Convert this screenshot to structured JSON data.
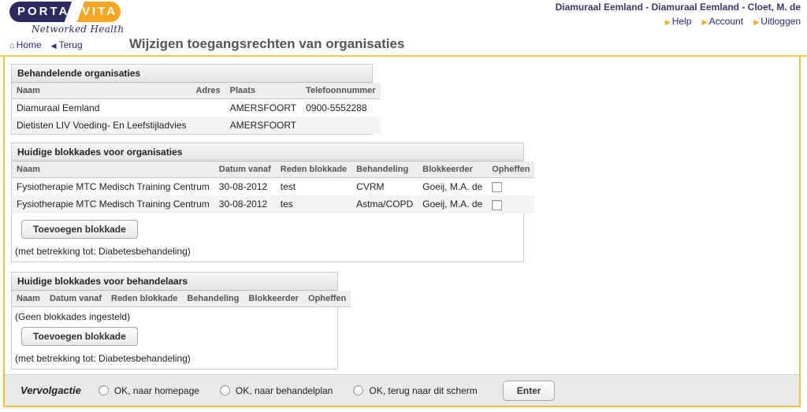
{
  "header": {
    "logo": {
      "text_left": "PORTA",
      "text_right": "VITA",
      "tagline": "Networked Health"
    },
    "user_context": "Diamuraal Eemland - Diamuraal Eemland - Cloet, M. de",
    "links": [
      {
        "label": "Help",
        "icon": "arrow-right-icon"
      },
      {
        "label": "Account",
        "icon": "arrow-right-icon"
      },
      {
        "label": "Uitloggen",
        "icon": "arrow-right-icon"
      }
    ]
  },
  "nav": {
    "home_label": "Home",
    "home_icon": "home-icon",
    "back_label": "Terug",
    "back_icon": "arrow-left-icon"
  },
  "page_title": "Wijzigen toegangsrechten van organisaties",
  "sections": {
    "organisaties": {
      "title": "Behandelende organisaties",
      "columns": [
        "Naam",
        "Adres",
        "Plaats",
        "Telefoonnummer"
      ],
      "rows": [
        {
          "naam": "Diamuraal Eemland",
          "adres": "",
          "plaats": "AMERSFOORT",
          "telefoonnummer": "0900-5552288"
        },
        {
          "naam": "Dietisten LIV Voeding- En Leefstijladvies",
          "adres": "",
          "plaats": "AMERSFOORT",
          "telefoonnummer": ""
        }
      ]
    },
    "blokkades_organisaties": {
      "title": "Huidige blokkades voor organisaties",
      "columns": [
        "Naam",
        "Datum vanaf",
        "Reden blokkade",
        "Behandeling",
        "Blokkeerder",
        "Opheffen"
      ],
      "rows": [
        {
          "naam": "Fysiotherapie MTC Medisch Training Centrum",
          "datum_vanaf": "30-08-2012",
          "reden_blokkade": "test",
          "behandeling": "CVRM",
          "blokkeerder": "Goeij, M.A. de",
          "opheffen_checked": false
        },
        {
          "naam": "Fysiotherapie MTC Medisch Training Centrum",
          "datum_vanaf": "30-08-2012",
          "reden_blokkade": "tes",
          "behandeling": "Astma/COPD",
          "blokkeerder": "Goeij, M.A. de",
          "opheffen_checked": false
        }
      ],
      "add_button": "Toevoegen blokkade",
      "note": "(met betrekking tot: Diabetesbehandeling)"
    },
    "blokkades_behandelaars": {
      "title": "Huidige blokkades voor behandelaars",
      "columns": [
        "Naam",
        "Datum vanaf",
        "Reden blokkade",
        "Behandeling",
        "Blokkeerder",
        "Opheffen"
      ],
      "empty_message": "(Geen blokkades ingesteld)",
      "add_button": "Toevoegen blokkade",
      "note": "(met betrekking tot: Diabetesbehandeling)"
    }
  },
  "action_bar": {
    "label": "Vervolgactie",
    "options": [
      {
        "label": "OK, naar homepage",
        "selected": false
      },
      {
        "label": "OK, naar behandelplan",
        "selected": false
      },
      {
        "label": "OK, terug naar dit scherm",
        "selected": false
      }
    ],
    "submit_label": "Enter"
  },
  "colors": {
    "brand_navy": "#2b2b5f",
    "brand_orange": "#f5a623",
    "panel_border": "#f0c040",
    "header_rule": "#f5c242",
    "link": "#2b2b7f",
    "row_alt": "#f4f4f7",
    "bar_bg": "#e9e9e9"
  }
}
